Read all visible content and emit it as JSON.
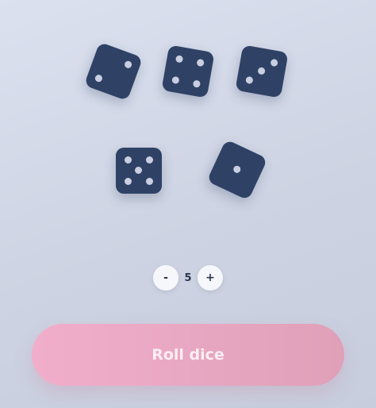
{
  "dice": [
    {
      "value": 2,
      "face_icon": "die-face-2-icon"
    },
    {
      "value": 4,
      "face_icon": "die-face-4-icon"
    },
    {
      "value": 3,
      "face_icon": "die-face-3-icon"
    },
    {
      "value": 5,
      "face_icon": "die-face-5-icon"
    },
    {
      "value": 1,
      "face_icon": "die-face-1-icon"
    }
  ],
  "stepper": {
    "minus_label": "-",
    "count": "5",
    "plus_label": "+"
  },
  "roll_button": {
    "label": "Roll dice"
  },
  "colors": {
    "die": "#2f4266",
    "pip": "#c9cfe0",
    "roll_button": "#efabc7"
  }
}
